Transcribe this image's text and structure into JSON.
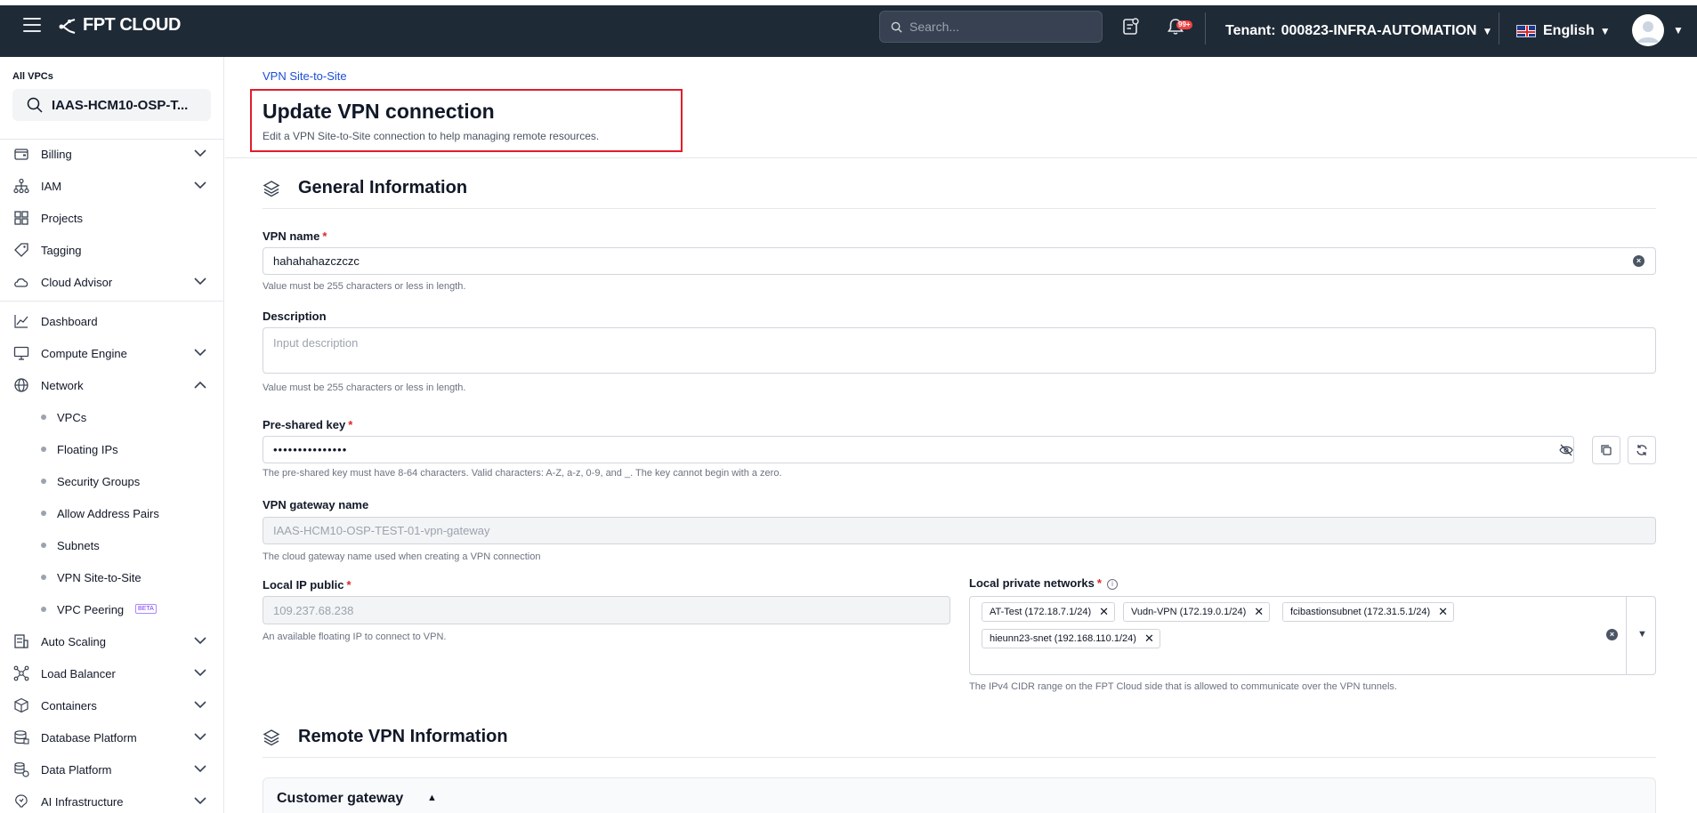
{
  "app": {
    "logo_text": "FPT CLOUD"
  },
  "topbar": {
    "search_placeholder": "Search...",
    "notif_badge": "99+",
    "tenant_label": "Tenant:",
    "tenant_value": "000823-INFRA-AUTOMATION",
    "language": "English"
  },
  "sidebar": {
    "vpc_label": "All VPCs",
    "vpc_selected": "IAAS-HCM10-OSP-T...",
    "items": [
      {
        "label": "Billing",
        "icon": "wallet-icon",
        "expandable": true
      },
      {
        "label": "IAM",
        "icon": "org-tree-icon",
        "expandable": true
      },
      {
        "label": "Projects",
        "icon": "projects-grid-icon",
        "expandable": false
      },
      {
        "label": "Tagging",
        "icon": "tag-icon",
        "expandable": false
      },
      {
        "label": "Cloud Advisor",
        "icon": "cloud-advisor-icon",
        "expandable": true
      },
      {
        "label": "Dashboard",
        "icon": "chart-line-icon",
        "expandable": false
      },
      {
        "label": "Compute Engine",
        "icon": "monitor-icon",
        "expandable": true
      },
      {
        "label": "Network",
        "icon": "globe-icon",
        "expandable": true,
        "expanded": true
      },
      {
        "label": "Auto Scaling",
        "icon": "auto-scaling-icon",
        "expandable": true
      },
      {
        "label": "Load Balancer",
        "icon": "load-balancer-icon",
        "expandable": true
      },
      {
        "label": "Containers",
        "icon": "cube-icon",
        "expandable": true
      },
      {
        "label": "Database Platform",
        "icon": "database-icon",
        "expandable": true
      },
      {
        "label": "Data Platform",
        "icon": "data-platform-icon",
        "expandable": true
      },
      {
        "label": "AI Infrastructure",
        "icon": "ai-icon",
        "expandable": true
      }
    ],
    "network_sub": [
      {
        "label": "VPCs"
      },
      {
        "label": "Floating IPs"
      },
      {
        "label": "Security Groups"
      },
      {
        "label": "Allow Address Pairs"
      },
      {
        "label": "Subnets"
      },
      {
        "label": "VPN Site-to-Site"
      },
      {
        "label": "VPC Peering",
        "badge": "BETA"
      }
    ]
  },
  "page": {
    "breadcrumb": "VPN Site-to-Site",
    "title": "Update VPN connection",
    "subtitle": "Edit a VPN Site-to-Site connection to help managing remote resources.",
    "highlight_color": "#e11d2a"
  },
  "general": {
    "heading": "General Information",
    "vpn_name": {
      "label": "VPN name",
      "value": "hahahahazczczc",
      "help": "Value must be 255 characters or less in length."
    },
    "description": {
      "label": "Description",
      "placeholder": "Input description",
      "help": "Value must be 255 characters or less in length."
    },
    "psk": {
      "label": "Pre-shared key",
      "value": "•••••••••••••••",
      "help": "The pre-shared key must have 8-64 characters. Valid characters: A-Z, a-z, 0-9, and _. The key cannot begin with a zero."
    },
    "gateway": {
      "label": "VPN gateway name",
      "value": "IAAS-HCM10-OSP-TEST-01-vpn-gateway",
      "help": "The cloud gateway name used when creating a VPN connection"
    },
    "local_ip": {
      "label": "Local IP public",
      "value": "109.237.68.238",
      "help": "An available floating IP to connect to VPN."
    },
    "local_networks": {
      "label": "Local private networks",
      "chips": [
        "AT-Test (172.18.7.1/24)",
        "Vudn-VPN (172.19.0.1/24)",
        "fcibastionsubnet (172.31.5.1/24)",
        "hieunn23-snet (192.168.110.1/24)"
      ],
      "help": "The IPv4 CIDR range on the FPT Cloud side that is allowed to communicate over the VPN tunnels."
    }
  },
  "remote": {
    "heading": "Remote VPN Information",
    "card_title": "Customer gateway"
  }
}
